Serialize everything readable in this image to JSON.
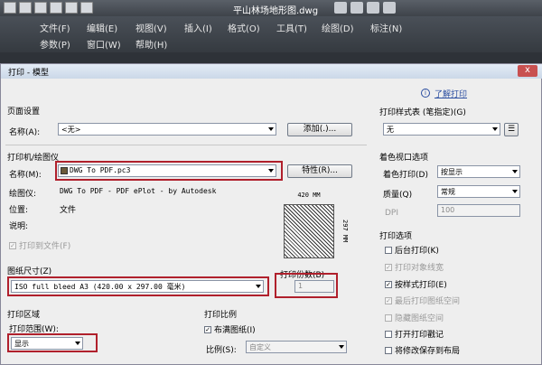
{
  "app": {
    "title": "平山林场地形图.dwg"
  },
  "menus": {
    "row1": [
      "文件(F)",
      "编辑(E)",
      "视图(V)",
      "插入(I)",
      "格式(O)",
      "工具(T)",
      "绘图(D)",
      "标注(N)"
    ],
    "row2": [
      "参数(P)",
      "窗口(W)",
      "帮助(H)"
    ]
  },
  "dialog": {
    "title": "打印 - 模型",
    "close_label": "x",
    "learn_link": "了解打印",
    "page_setup": {
      "heading": "页面设置",
      "name_label": "名称(A):",
      "name_value": "<无>",
      "add_label": "添加(.)..."
    },
    "printer": {
      "heading": "打印机/绘图仪",
      "name_label": "名称(M):",
      "name_value": "DWG To PDF.pc3",
      "props_label": "特性(R)...",
      "plotter_label": "绘图仪:",
      "plotter_value": "DWG To PDF - PDF ePlot - by Autodesk",
      "location_label": "位置:",
      "location_value": "文件",
      "desc_label": "说明:",
      "print_to_file": "打印到文件(F)",
      "preview_width": "420 MM",
      "preview_height": "297 MM"
    },
    "paper": {
      "heading": "图纸尺寸(Z)",
      "value": "ISO full bleed A3 (420.00 x 297.00 毫米)"
    },
    "copies": {
      "heading": "打印份数(B)",
      "value": "1"
    },
    "area": {
      "heading": "打印区域",
      "range_label": "打印范围(W):",
      "range_value": "显示"
    },
    "scale": {
      "heading": "打印比例",
      "fit_label": "布满图纸(I)",
      "ratio_label": "比例(S):",
      "ratio_value": "自定义"
    },
    "style_table": {
      "heading": "打印样式表 (笔指定)(G)",
      "value": "无"
    },
    "shaded": {
      "heading": "着色视口选项",
      "shade_label": "着色打印(D)",
      "shade_value": "按显示",
      "quality_label": "质量(Q)",
      "quality_value": "常规",
      "dpi_label": "DPI",
      "dpi_value": "100"
    },
    "options": {
      "heading": "打印选项",
      "items": [
        {
          "label": "后台打印(K)",
          "checked": false,
          "enabled": true
        },
        {
          "label": "打印对象线宽",
          "checked": true,
          "enabled": false
        },
        {
          "label": "按样式打印(E)",
          "checked": true,
          "enabled": true
        },
        {
          "label": "最后打印图纸空间",
          "checked": true,
          "enabled": false
        },
        {
          "label": "隐藏图纸空间",
          "checked": false,
          "enabled": false
        },
        {
          "label": "打开打印戳记",
          "checked": false,
          "enabled": true
        },
        {
          "label": "将修改保存到布局",
          "checked": false,
          "enabled": true
        }
      ]
    }
  },
  "colors": {
    "highlight": "#b0202c",
    "link": "#2a4da0"
  }
}
